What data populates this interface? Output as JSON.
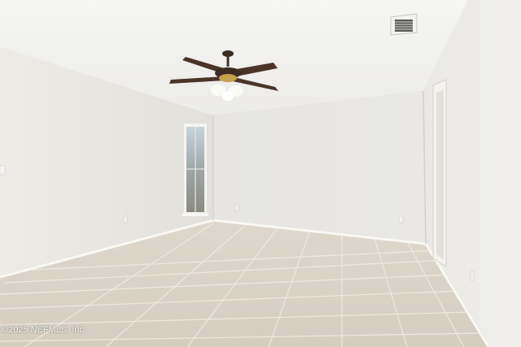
{
  "photo": {
    "watermark": "©2025 NEFMLS, Inc"
  }
}
